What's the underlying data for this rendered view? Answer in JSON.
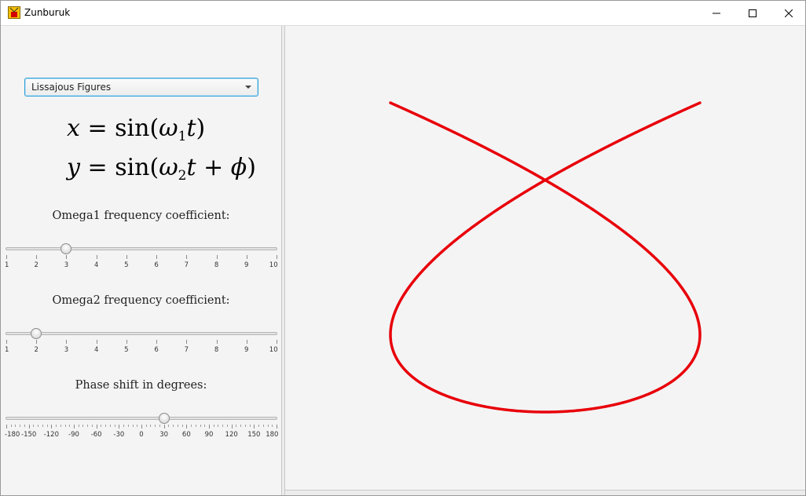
{
  "window": {
    "title": "Zunburuk",
    "controls": {
      "minimize": "minimize-icon",
      "maximize": "maximize-icon",
      "close": "close-icon"
    }
  },
  "sidebar": {
    "figure_select": {
      "selected": "Lissajous Figures"
    },
    "formula_x": {
      "lhs": "x",
      "eq": "=",
      "fn": "sin(",
      "omega": "ω",
      "sub": "1",
      "t": "t",
      "close": ")"
    },
    "formula_y": {
      "lhs": "y",
      "eq": "=",
      "fn": "sin(",
      "omega": "ω",
      "sub": "2",
      "t": "t",
      "plus": "+",
      "phi": "ϕ",
      "close": ")"
    },
    "sliders": [
      {
        "id": "omega1",
        "title": "Omega1 frequency coefficient:",
        "min": 1,
        "max": 10,
        "value": 3,
        "ticks": [
          "1",
          "2",
          "3",
          "4",
          "5",
          "6",
          "7",
          "8",
          "9",
          "10"
        ],
        "minor_per_major": 0
      },
      {
        "id": "omega2",
        "title": "Omega2 frequency coefficient:",
        "min": 1,
        "max": 10,
        "value": 2,
        "ticks": [
          "1",
          "2",
          "3",
          "4",
          "5",
          "6",
          "7",
          "8",
          "9",
          "10"
        ],
        "minor_per_major": 0
      },
      {
        "id": "phase",
        "title": "Phase shift in degrees:",
        "min": -180,
        "max": 180,
        "value": 30,
        "ticks": [
          "-180",
          "-150",
          "-120",
          "-90",
          "-60",
          "-30",
          "0",
          "30",
          "60",
          "90",
          "120",
          "150",
          "180"
        ],
        "minor_per_major": 5
      }
    ]
  },
  "canvas": {
    "curve": {
      "color": "#e8000a",
      "omega1": 3,
      "omega2": 2,
      "phase_deg": 30
    }
  },
  "colors": {
    "accent": "#2a9fd6",
    "curve": "#e8000a",
    "background": "#f4f4f4"
  }
}
